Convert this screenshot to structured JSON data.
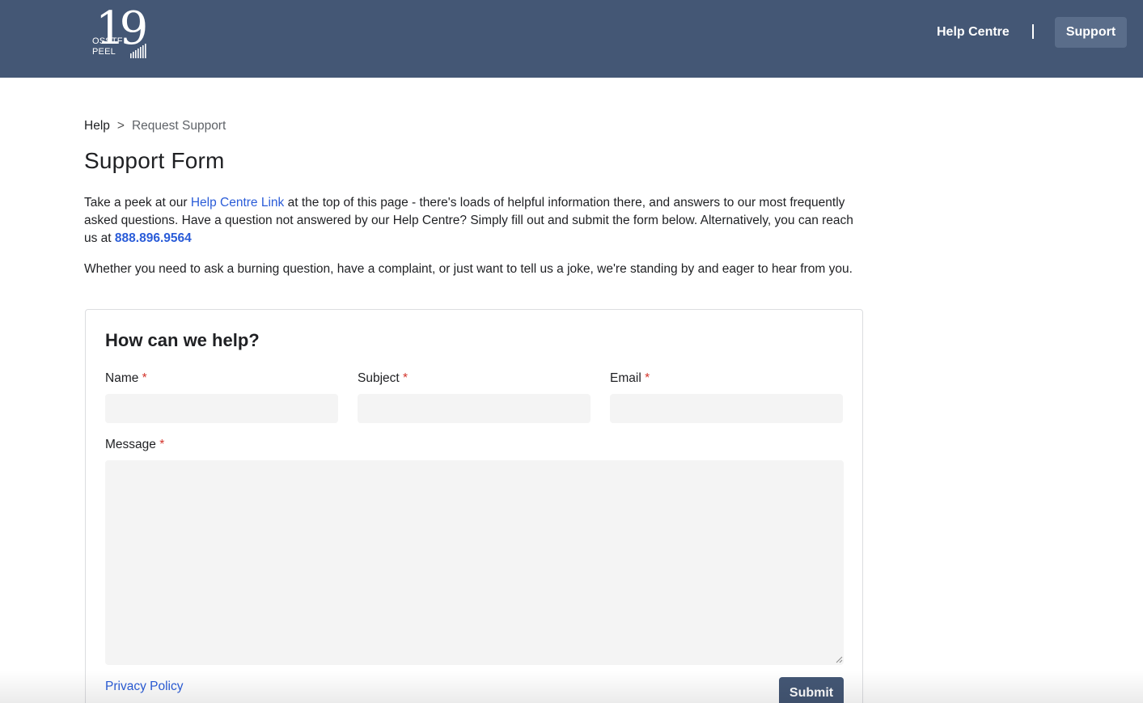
{
  "header": {
    "logo": {
      "number": "19",
      "line1": "OSSTF",
      "line2": "PEEL"
    },
    "nav": {
      "help_centre": "Help Centre",
      "support": "Support"
    }
  },
  "breadcrumb": {
    "home": "Help",
    "separator": ">",
    "current": "Request Support"
  },
  "page_title": "Support Form",
  "intro": {
    "p1_before": "Take a peek at our ",
    "p1_link": "Help Centre Link",
    "p1_middle": " at the top of this page - there's loads of helpful information there, and answers to our most frequently asked questions. Have a question not answered by our Help Centre? Simply fill out and submit the form below. Alternatively, you can reach us at ",
    "p1_phone": "888.896.9564",
    "p2": "Whether you need to ask a burning question, have a complaint, or just want to tell us a joke, we're standing by and eager to hear from you."
  },
  "form": {
    "title": "How can we help?",
    "required_marker": "*",
    "name_label": "Name",
    "name_value": "",
    "subject_label": "Subject",
    "subject_value": "",
    "email_label": "Email",
    "email_value": "",
    "message_label": "Message",
    "message_value": "",
    "privacy_link": "Privacy Policy",
    "submit_label": "Submit"
  },
  "colors": {
    "header_bg": "#445775",
    "link": "#2a5cd8",
    "required": "#d3332a",
    "input_bg": "#f4f4f4"
  }
}
